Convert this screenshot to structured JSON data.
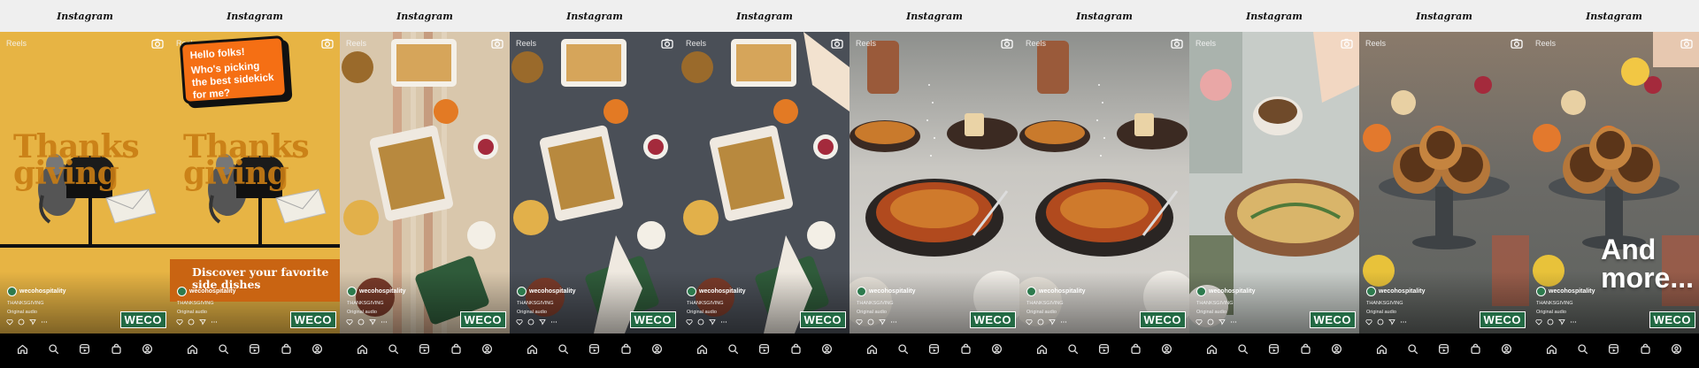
{
  "app": {
    "title": "Instagram"
  },
  "feed": {
    "section_label": "Reels"
  },
  "post": {
    "account": "wecohospitality",
    "caption": "THANKSGIVING",
    "audio": "Original audio",
    "brand_badge": "WECO"
  },
  "overlays": {
    "speech_greeting": "Hello folks!",
    "speech_question": "Who's picking the best sidekick for me?",
    "big_word_1": "Thanks",
    "big_word_2": "giving",
    "discover_line_1": "Discover your favorite",
    "discover_line_2": "side dishes",
    "closing_line_1": "And",
    "closing_line_2": "more..."
  },
  "colors": {
    "mustard": "#e7b444",
    "orange": "#f56f14",
    "weco_green": "#236a44",
    "nav_bg": "#000000"
  },
  "icons": {
    "nav": [
      "home-icon",
      "search-icon",
      "reels-icon",
      "shop-icon",
      "profile-icon"
    ],
    "actions": [
      "heart-icon",
      "comment-icon",
      "send-icon",
      "more-icon"
    ],
    "header_right": "camera-icon"
  }
}
